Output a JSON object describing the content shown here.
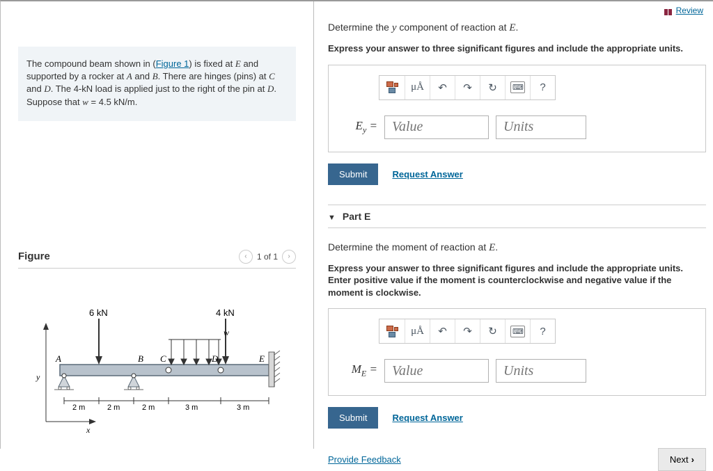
{
  "header": {
    "review_label": "Review"
  },
  "problem": {
    "text_prefix": "The compound beam shown in (",
    "figure_link": "Figure 1",
    "text_after_link": ") is fixed at ",
    "E": "E",
    "text2": " and supported by a rocker at ",
    "A": "A",
    "text3": " and ",
    "B": "B",
    "text4": ". There are hinges (pins) at ",
    "C": "C",
    "text5": " and ",
    "D": "D",
    "text6": ". The 4-kN load is applied just to the right of the pin at ",
    "D2": "D",
    "text7": ". Suppose that ",
    "w": "w",
    "text8": " = 4.5 kN/m."
  },
  "figure": {
    "title": "Figure",
    "pager_text": "1 of 1",
    "labels": {
      "load1": "6 kN",
      "load2": "4 kN",
      "w": "w",
      "A": "A",
      "B": "B",
      "C": "C",
      "D": "D",
      "E": "E",
      "y": "y",
      "x": "x",
      "d1": "2 m",
      "d2": "2 m",
      "d3": "2 m",
      "d4": "3 m",
      "d5": "3 m"
    }
  },
  "q1": {
    "prompt_prefix": "Determine the ",
    "y": "y",
    "prompt_mid": " component of reaction at ",
    "E": "E",
    "prompt_suffix": ".",
    "instructions": "Express your answer to three significant figures and include the appropriate units.",
    "var_label": "E",
    "var_sub": "y",
    "equals": " =",
    "value_placeholder": "Value",
    "units_placeholder": "Units",
    "submit": "Submit",
    "request": "Request Answer"
  },
  "partE": {
    "header": "Part E",
    "prompt_prefix": "Determine the moment of reaction at ",
    "E": "E",
    "prompt_suffix": ".",
    "instructions": "Express your answer to three significant figures and include the appropriate units. Enter positive value if the moment is counterclockwise and negative value if the moment is clockwise.",
    "var_label": "M",
    "var_sub": "E",
    "equals": " =",
    "value_placeholder": "Value",
    "units_placeholder": "Units",
    "submit": "Submit",
    "request": "Request Answer"
  },
  "footer": {
    "provide_feedback": "Provide Feedback",
    "next": "Next"
  },
  "toolbar": {
    "mu": "μÅ",
    "undo": "↶",
    "redo": "↷",
    "reset": "↻",
    "help": "?"
  }
}
